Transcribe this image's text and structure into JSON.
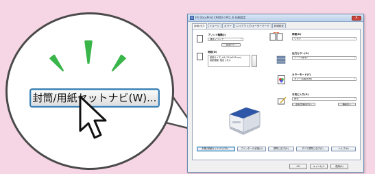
{
  "magnifier": {
    "button_label": "封筒/用紙セットナビ(W)..."
  },
  "dialog": {
    "title": "FX DocuPrint CP400 d PCL 6 印刷設定",
    "close_label": "✕",
    "tabs": [
      {
        "label": "用紙/出力"
      },
      {
        "label": "イメージ"
      },
      {
        "label": "カラー"
      },
      {
        "label": "レイアウト/ウォーターマーク"
      },
      {
        "label": "詳細設定"
      }
    ],
    "job_type": {
      "label": "プリント種類(J)",
      "value": "通常プリント",
      "settings_button": "設定(O)..."
    },
    "paper_size": {
      "label": "用紙(D)",
      "lines": [
        "原稿サイズ: A4 (210x297mm)",
        "用紙種類: 指定しない"
      ]
    },
    "duplex": {
      "label": "両面(D)",
      "value": "しない"
    },
    "output_color": {
      "label": "出力カラー(O)",
      "value": "ソート(標準)"
    },
    "color_mode": {
      "label": "カラーモード(C)",
      "value": "カラー(自動判別)"
    },
    "favorites": {
      "label": "お気に入り(G)",
      "value": "標準",
      "save_button": "設定を保存(S)...",
      "edit_button": "編集(I)..."
    },
    "bottom_buttons": {
      "envelope_nav": "封筒/用紙セットナビ(W)...",
      "printer_status": "プリンターの状態(U)",
      "restore_standard": "標準に戻す(R)",
      "restore_all": "すべて標準に戻す(E)",
      "help": "ヘルプ(H)"
    },
    "footer": {
      "ok": "OK",
      "cancel": "キャンセル",
      "apply": "適用(A)"
    }
  }
}
